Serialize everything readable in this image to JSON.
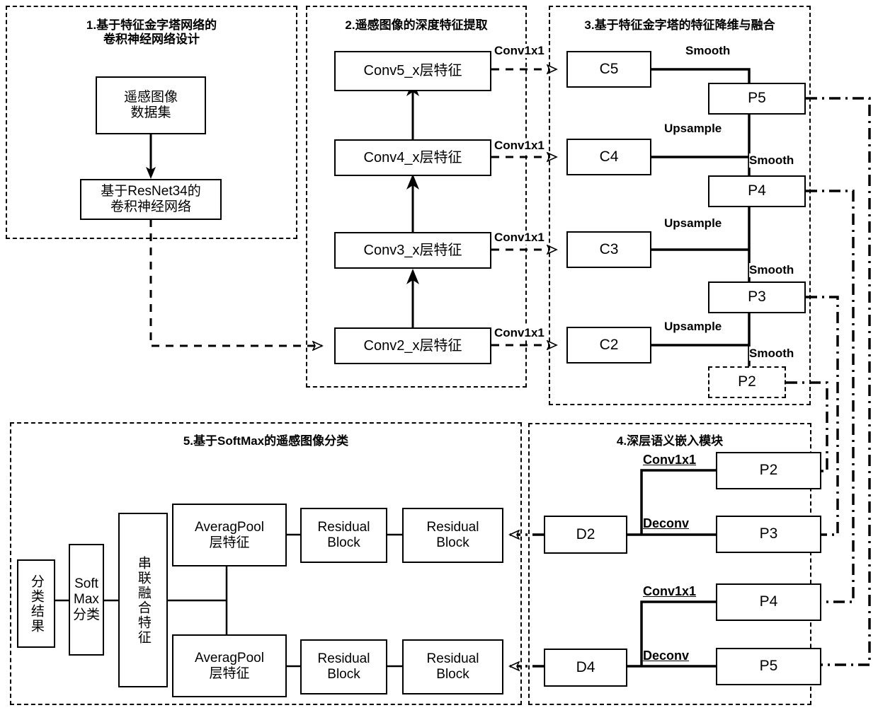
{
  "figure": {
    "title_hidden": "",
    "accent": "#000000",
    "background": "#ffffff"
  },
  "panels": [
    {
      "id": "p1",
      "title": "1.基于特征金字塔网络的\n卷积神经网络设计"
    },
    {
      "id": "p2",
      "title": "2.遥感图像的深度特征提取"
    },
    {
      "id": "p3",
      "title": "3.基于特征金字塔的特征降维与融合"
    },
    {
      "id": "p4",
      "title": "4.深层语义嵌入模块"
    },
    {
      "id": "p5",
      "title": "5.基于SoftMax的遥感图像分类"
    }
  ],
  "panel1": {
    "dataset_box": "遥感图像\n数据集",
    "backbone_box": "基于ResNet34的\n卷积神经网络"
  },
  "panel2": {
    "boxes": [
      {
        "label": "Conv5_x层特征"
      },
      {
        "label": "Conv4_x层特征"
      },
      {
        "label": "Conv3_x层特征"
      },
      {
        "label": "Conv2_x层特征"
      }
    ],
    "edge_labels": [
      "Conv1x1",
      "Conv1x1",
      "Conv1x1",
      "Conv1x1"
    ]
  },
  "panel3": {
    "c_boxes": [
      {
        "label": "C5"
      },
      {
        "label": "C4"
      },
      {
        "label": "C3"
      },
      {
        "label": "C2"
      }
    ],
    "p_boxes": [
      {
        "label": "P5",
        "style": "solid"
      },
      {
        "label": "P4",
        "style": "solid"
      },
      {
        "label": "P3",
        "style": "solid"
      },
      {
        "label": "P2",
        "style": "dashed"
      }
    ],
    "smooth_labels": [
      "Smooth",
      "Smooth",
      "Smooth",
      "Smooth"
    ],
    "upsample_labels": [
      "Upsample",
      "Upsample",
      "Upsample"
    ]
  },
  "panel4": {
    "d_boxes": [
      {
        "label": "D2"
      },
      {
        "label": "D4"
      }
    ],
    "out_boxes": [
      {
        "label": "P2"
      },
      {
        "label": "P3"
      },
      {
        "label": "P4"
      },
      {
        "label": "P5"
      }
    ],
    "op_labels": [
      "Conv1x1",
      "Deconv",
      "Conv1x1",
      "Deconv"
    ]
  },
  "panel5": {
    "result_box": "分类结果",
    "softmax_box": "Soft\nMax\n分类",
    "concat_box": "串联融合特征",
    "pool_boxes": [
      "AveragPool\n层特征",
      "AveragPool\n层特征"
    ],
    "residual_boxes": [
      "Residual\nBlock",
      "Residual\nBlock",
      "Residual\nBlock",
      "Residual\nBlock"
    ]
  }
}
